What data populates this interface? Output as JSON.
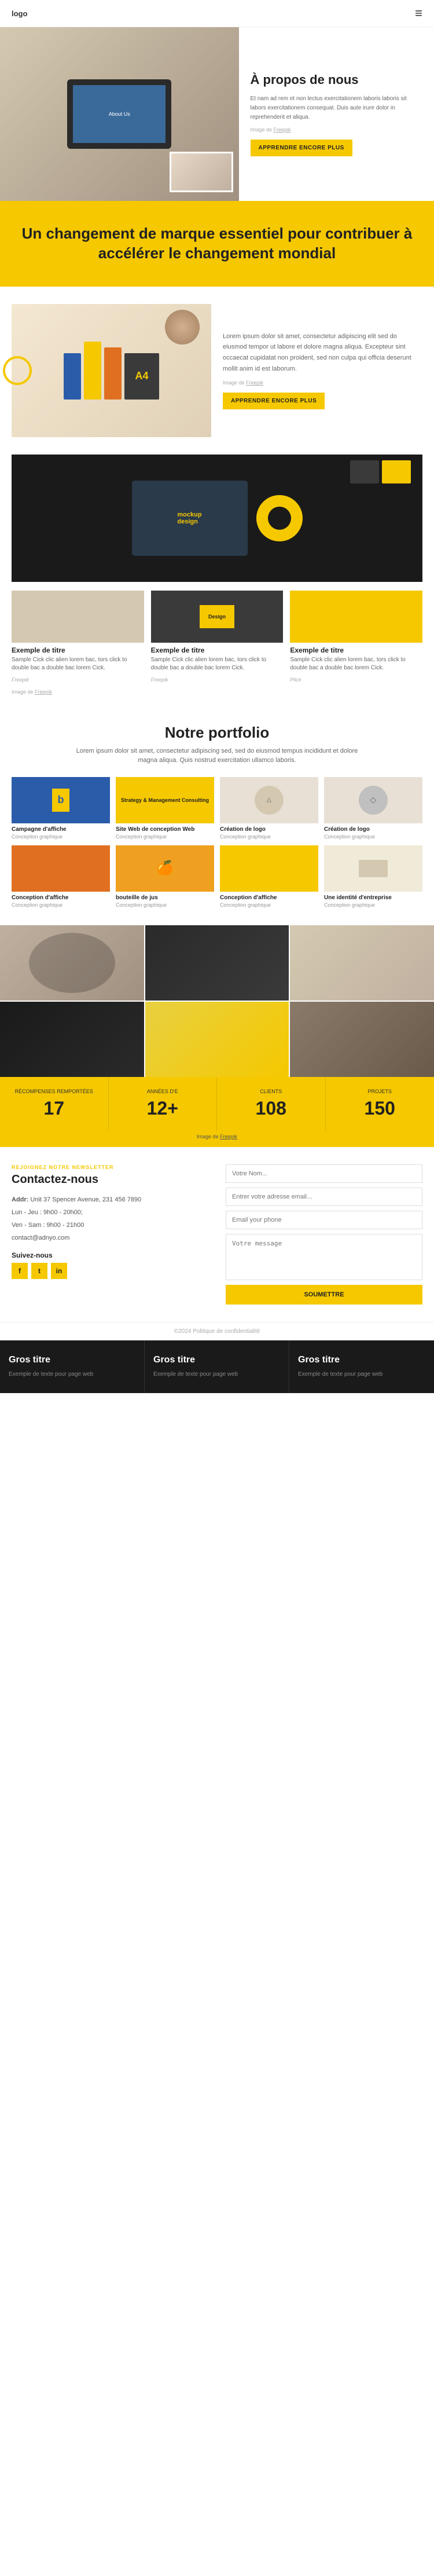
{
  "nav": {
    "logo": "logo",
    "hamburger": "≡"
  },
  "hero": {
    "title": "À propos de nous",
    "text": "Et nam ad rem et non lectus exercitationem laboris laboris sit labors exercitationem consequat. Duis aute irure dolor in reprehenderit et aliqua.",
    "credit_label": "Image de",
    "credit_link": "Freepik",
    "cta": "APPRENDRE ENCORE PLUS"
  },
  "brand": {
    "title": "Un changement de marque essentiel pour contribuer à accélérer le changement mondial"
  },
  "mockup": {
    "text": "Lorem ipsum dolor sit amet, consectetur adipiscing elit sed do eiusmod tempor ut labore et dolore magna aliqua. Excepteur sint occaecat cupidatat non proident, sed non culpa qui officia deserunt mollit anim id est laborum.",
    "credit_label": "Image de",
    "credit_link": "Freepik",
    "cta": "APPRENDRE ENCORE PLUS"
  },
  "devices": {
    "credit_label": "Image de",
    "credit_link": "Freepik",
    "cards": [
      {
        "title": "Exemple de titre",
        "text": "Sample Cick clic alien lorem bac, tors click to double bac a double bac lorem Cick.",
        "tag": "Freepik"
      },
      {
        "title": "Exemple de titre",
        "text": "Sample Cick clic alien lorem bac, tors click to double bac a double bac lorem Cick.",
        "tag": "Freepik"
      },
      {
        "title": "Exemple de titre",
        "text": "Sample Cick clic alien lorem bac, tors click to double bac a double bac lorem Cick.",
        "tag": "Plick"
      }
    ]
  },
  "portfolio": {
    "title": "Notre portfolio",
    "subtitle": "Lorem ipsum dolor sit amet, consectetur adipiscing sed, sed do eiusmod tempus incididunt et dolore magna aliqua. Quis nostrud exercitation ullamco laboris.",
    "items": [
      {
        "title": "Campagne d'affiche",
        "category": "Conception graphique",
        "color": "blue"
      },
      {
        "title": "Site Web de conception Web",
        "category": "Conception graphique",
        "color": "yellow-bg"
      },
      {
        "title": "Création de logo",
        "category": "Conception graphique",
        "color": "light"
      },
      {
        "title": "Création de logo",
        "category": "Conception graphique",
        "color": "dark"
      },
      {
        "title": "Conception d'affiche",
        "category": "Conception graphique",
        "color": "orange"
      },
      {
        "title": "bouteille de jus",
        "category": "Conception graphique",
        "color": "green"
      },
      {
        "title": "Conception d'affiche",
        "category": "Conception graphique",
        "color": "yellow-bg"
      },
      {
        "title": "Une identité d'entreprise",
        "category": "Conception graphique",
        "color": "pink"
      }
    ]
  },
  "stats": {
    "credit_label": "Image de",
    "credit_link": "Freepik",
    "items": [
      {
        "label": "RÉCOMPENSES REMPORTÉES",
        "value": "17"
      },
      {
        "label": "ANNÉES D'E",
        "value": "12+"
      },
      {
        "label": "CLIENTS",
        "value": "108"
      },
      {
        "label": "PROJETS",
        "value": "150"
      }
    ]
  },
  "contact": {
    "newsletter_label": "REJOIGNEZ NOTRE NEWSLETTER",
    "title": "Contactez-nous",
    "address_label": "Addr:",
    "address": "Unit 37 Spencer Avenue, 231 456 7890",
    "hours": "Lun - Jeu : 9h00 - 20h00;",
    "hours2": "Ven - Sam : 9h00 - 21h00",
    "email": "contact@adnyo.com",
    "social_title": "Suivez-nous",
    "social_icons": [
      "f",
      "t",
      "in"
    ],
    "form": {
      "name_placeholder": "Votre Nom...",
      "email_placeholder": "Entrer votre adresse email...",
      "phone_placeholder": "Email your phone",
      "message_placeholder": "Votre message",
      "submit_label": "SOUMETTRE"
    },
    "copyright": "©2024 Politique de confidentialité"
  },
  "footer": {
    "cols": [
      {
        "title": "Gros titre",
        "text": "Exemple de texte pour page web"
      },
      {
        "title": "Gros titre",
        "text": "Exemple de texte pour page web"
      },
      {
        "title": "Gros titre",
        "text": "Exemple de texte pour page web"
      }
    ]
  }
}
